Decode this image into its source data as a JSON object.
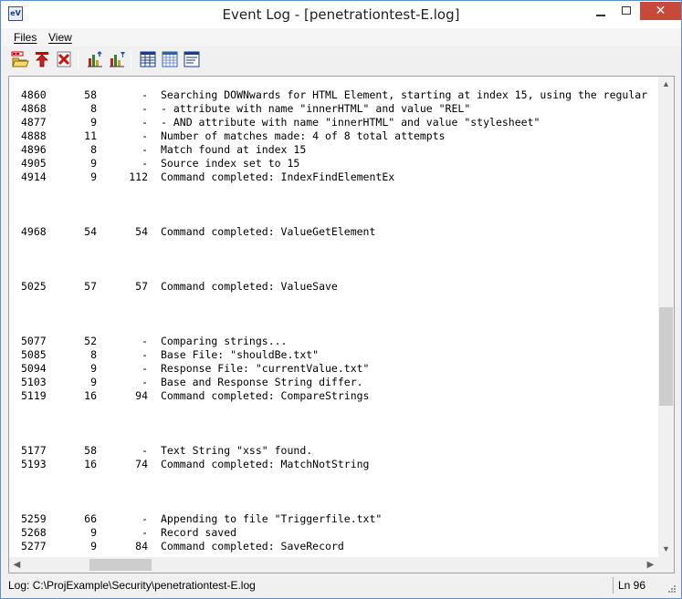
{
  "window": {
    "title": "Event Log - [penetrationtest-E.log]",
    "app_icon_text": "eV",
    "close_glyph": "✕"
  },
  "menu": {
    "files_label": "Files",
    "view_label": "View"
  },
  "toolbar": {
    "icons": [
      "open-log-icon",
      "upload-icon",
      "close-log-icon",
      "chart-icon",
      "chart-filter-icon",
      "grid-view-icon",
      "table-view-icon",
      "text-view-icon"
    ]
  },
  "log": {
    "rows": [
      {
        "idx": "4860",
        "a": "58",
        "b": "-",
        "msg": "Searching DOWNwards for HTML Element, starting at index 15, using the regular"
      },
      {
        "idx": "4868",
        "a": "8",
        "b": "-",
        "msg": "- attribute with name \"innerHTML\" and value \"REL\""
      },
      {
        "idx": "4877",
        "a": "9",
        "b": "-",
        "msg": "- AND attribute with name \"innerHTML\" and value \"stylesheet\""
      },
      {
        "idx": "4888",
        "a": "11",
        "b": "-",
        "msg": "Number of matches made: 4 of 8 total attempts"
      },
      {
        "idx": "4896",
        "a": "8",
        "b": "-",
        "msg": "Match found at index 15"
      },
      {
        "idx": "4905",
        "a": "9",
        "b": "-",
        "msg": "Source index set to 15"
      },
      {
        "idx": "4914",
        "a": "9",
        "b": "112",
        "msg": "Command completed: IndexFindElementEx"
      },
      {
        "idx": "",
        "a": "",
        "b": "",
        "msg": ""
      },
      {
        "idx": "",
        "a": "",
        "b": "",
        "msg": ""
      },
      {
        "idx": "",
        "a": "",
        "b": "",
        "msg": ""
      },
      {
        "idx": "4968",
        "a": "54",
        "b": "54",
        "msg": "Command completed: ValueGetElement"
      },
      {
        "idx": "",
        "a": "",
        "b": "",
        "msg": ""
      },
      {
        "idx": "",
        "a": "",
        "b": "",
        "msg": ""
      },
      {
        "idx": "",
        "a": "",
        "b": "",
        "msg": ""
      },
      {
        "idx": "5025",
        "a": "57",
        "b": "57",
        "msg": "Command completed: ValueSave"
      },
      {
        "idx": "",
        "a": "",
        "b": "",
        "msg": ""
      },
      {
        "idx": "",
        "a": "",
        "b": "",
        "msg": ""
      },
      {
        "idx": "",
        "a": "",
        "b": "",
        "msg": ""
      },
      {
        "idx": "5077",
        "a": "52",
        "b": "-",
        "msg": "Comparing strings..."
      },
      {
        "idx": "5085",
        "a": "8",
        "b": "-",
        "msg": "Base File: \"shouldBe.txt\""
      },
      {
        "idx": "5094",
        "a": "9",
        "b": "-",
        "msg": "Response File: \"currentValue.txt\""
      },
      {
        "idx": "5103",
        "a": "9",
        "b": "-",
        "msg": "Base and Response String differ."
      },
      {
        "idx": "5119",
        "a": "16",
        "b": "94",
        "msg": "Command completed: CompareStrings"
      },
      {
        "idx": "",
        "a": "",
        "b": "",
        "msg": ""
      },
      {
        "idx": "",
        "a": "",
        "b": "",
        "msg": ""
      },
      {
        "idx": "",
        "a": "",
        "b": "",
        "msg": ""
      },
      {
        "idx": "5177",
        "a": "58",
        "b": "-",
        "msg": "Text String \"xss\" found."
      },
      {
        "idx": "5193",
        "a": "16",
        "b": "74",
        "msg": "Command completed: MatchNotString"
      },
      {
        "idx": "",
        "a": "",
        "b": "",
        "msg": ""
      },
      {
        "idx": "",
        "a": "",
        "b": "",
        "msg": ""
      },
      {
        "idx": "",
        "a": "",
        "b": "",
        "msg": ""
      },
      {
        "idx": "5259",
        "a": "66",
        "b": "-",
        "msg": "Appending to file \"Triggerfile.txt\""
      },
      {
        "idx": "5268",
        "a": "9",
        "b": "-",
        "msg": "Record saved"
      },
      {
        "idx": "5277",
        "a": "9",
        "b": "84",
        "msg": "Command completed: SaveRecord"
      }
    ]
  },
  "statusbar": {
    "path": "Log: C:\\ProjExample\\Security\\penetrationtest-E.log",
    "line": "Ln 96"
  },
  "colors": {
    "close_button": "#c7493c",
    "window_border": "#5f8fc7"
  }
}
